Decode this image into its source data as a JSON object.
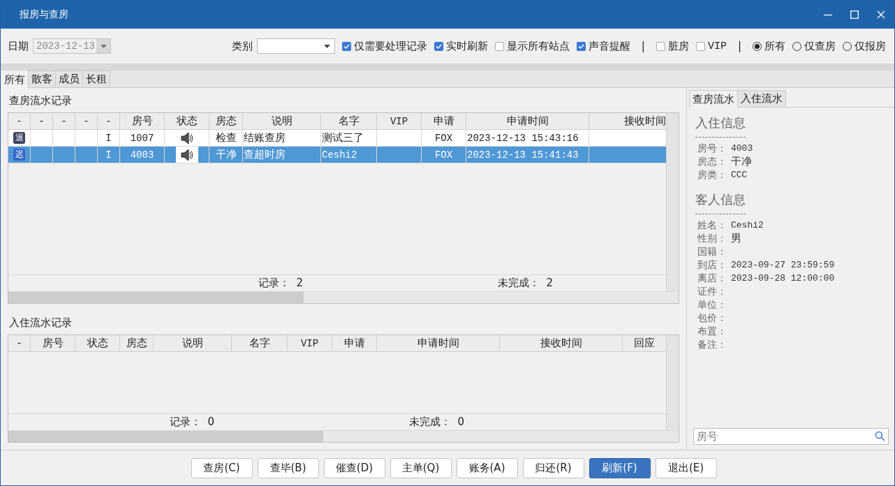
{
  "window": {
    "title": "报房与查房"
  },
  "toolbar": {
    "date": {
      "label": "日期",
      "value": "2023-12-13",
      "disabled": true
    },
    "category": {
      "label": "类别"
    },
    "options": [
      {
        "kind": "checkbox",
        "label": "仅需要处理记录",
        "checked": true
      },
      {
        "kind": "checkbox",
        "label": "实时刷新",
        "checked": true
      },
      {
        "kind": "checkbox",
        "label": "显示所有站点",
        "checked": false
      },
      {
        "kind": "checkbox",
        "label": "声音提醒",
        "checked": true
      },
      {
        "kind": "separator",
        "text": "|"
      },
      {
        "kind": "checkbox",
        "label": "脏房",
        "checked": false
      },
      {
        "kind": "checkbox",
        "label": "VIP",
        "checked": false
      },
      {
        "kind": "separator",
        "text": "|"
      },
      {
        "kind": "radio",
        "label": "所有",
        "selected": true
      },
      {
        "kind": "radio",
        "label": "仅查房",
        "selected": false
      },
      {
        "kind": "radio",
        "label": "仅报房",
        "selected": false
      }
    ]
  },
  "tabs": [
    {
      "label": "所有",
      "selected": true
    },
    {
      "label": "散客",
      "selected": false
    },
    {
      "label": "成员",
      "selected": false
    },
    {
      "label": "长租",
      "selected": false
    }
  ],
  "check_log": {
    "title": "查房流水记录",
    "columns": [
      "-",
      "-",
      "-",
      "-",
      "-",
      "房号",
      "状态",
      "房态",
      "说明",
      "名字",
      "VIP",
      "申请",
      "申请时间",
      "接收时间"
    ],
    "rows": [
      {
        "badge": "退",
        "color": "#3b4563",
        "flag": "I",
        "room": "1007",
        "sound": true,
        "room_state": "检查",
        "note": "结账查房",
        "name": "测试三了",
        "applicant": "FOX",
        "request_time": "2023-12-13 15:43:16",
        "selected": false
      },
      {
        "badge": "迟",
        "color": "#3567c8",
        "flag": "I",
        "room": "4003",
        "sound": true,
        "room_state": "干净",
        "note": "查超时房",
        "name": "Ceshi2",
        "applicant": "FOX",
        "request_time": "2023-12-13 15:41:43",
        "selected": true
      }
    ],
    "footer": [
      "记录：  2",
      "未完成：  2"
    ]
  },
  "checkin_log": {
    "title": "入住流水记录",
    "columns": [
      "-",
      "房号",
      "状态",
      "房态",
      "说明",
      "名字",
      "VIP",
      "申请",
      "申请时间",
      "接收时间",
      "回应"
    ],
    "footer": [
      "记录：  0",
      "未完成：  0"
    ]
  },
  "side_tabs": [
    {
      "label": "查房流水",
      "selected": true
    },
    {
      "label": "入住流水",
      "selected": false
    }
  ],
  "info_sections": [
    {
      "title": "入住信息",
      "fields": [
        {
          "label": "房号：",
          "value": "4003"
        },
        {
          "label": "房态：",
          "value": "干净"
        },
        {
          "label": "房类：",
          "value": "CCC"
        }
      ]
    },
    {
      "title": "客人信息",
      "fields": [
        {
          "label": "姓名：",
          "value": "Ceshi2"
        },
        {
          "label": "性别：",
          "value": "男"
        },
        {
          "label": "国籍："
        },
        {
          "label": "到店：",
          "value": "2023-09-27 23:59:59"
        },
        {
          "label": "离店：",
          "value": "2023-09-28 12:00:00"
        },
        {
          "label": "证件："
        },
        {
          "label": "单位："
        },
        {
          "label": "包价："
        },
        {
          "label": "布置："
        },
        {
          "label": "备注："
        }
      ]
    }
  ],
  "search": {
    "placeholder": "房号"
  },
  "buttons": [
    {
      "label": "查房(C)",
      "default": false
    },
    {
      "label": "查毕(B)",
      "default": false
    },
    {
      "label": "催查(D)",
      "default": false
    },
    {
      "label": "主单(Q)",
      "default": false
    },
    {
      "label": "账务(A)",
      "default": false
    },
    {
      "label": "归还(R)",
      "default": false
    },
    {
      "label": "刷新(F)",
      "default": true
    },
    {
      "label": "退出(E)",
      "default": false
    }
  ]
}
